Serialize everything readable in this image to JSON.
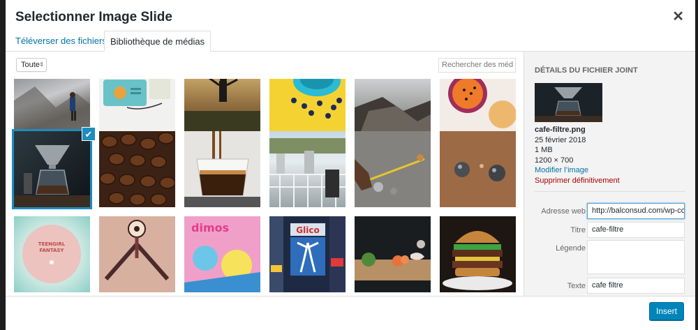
{
  "modal": {
    "title": "Selectionner Image Slide"
  },
  "tabs": [
    {
      "label": "Téléverser des fichiers"
    },
    {
      "label": "Bibliothèque de médias"
    }
  ],
  "toolbar": {
    "filter_value": "Toute",
    "search_placeholder": "Rechercher des méd"
  },
  "grid": {
    "rows": [
      [
        "mountain-climber",
        "teal-radio",
        "man-field-sunset",
        "blue-cup-yellow",
        "rocky-cliff",
        "passion-fruit"
      ],
      [
        "coffee-dripper",
        "coffee-beans",
        "espresso-glass",
        "city-balcony",
        "petanque-measure",
        "petanque-balls"
      ],
      [
        "record-label",
        "psychedelic-art",
        "comic-poster",
        "tokyo-signs",
        "chopping-veggies",
        "burger"
      ]
    ],
    "selected": "coffee-dripper"
  },
  "details": {
    "heading": "DÉTAILS DU FICHIER JOINT",
    "filename": "cafe-filtre.png",
    "date": "25 février 2018",
    "size": "1 MB",
    "dimensions": "1200 × 700",
    "edit_link": "Modifier l’image",
    "delete_link": "Supprimer définitivement"
  },
  "fields": {
    "url_label": "Adresse web",
    "url_value": "http://balconsud.com/wp-co",
    "title_label": "Titre",
    "title_value": "cafe-filtre",
    "caption_label": "Légende",
    "alt_label": "Texte",
    "alt_value": "cafe filtre"
  },
  "footer": {
    "insert_label": "Insert"
  },
  "colors": {
    "accent": "#0085ba",
    "link": "#0073aa",
    "danger": "#a00000",
    "selection": "#1e8cbe"
  }
}
